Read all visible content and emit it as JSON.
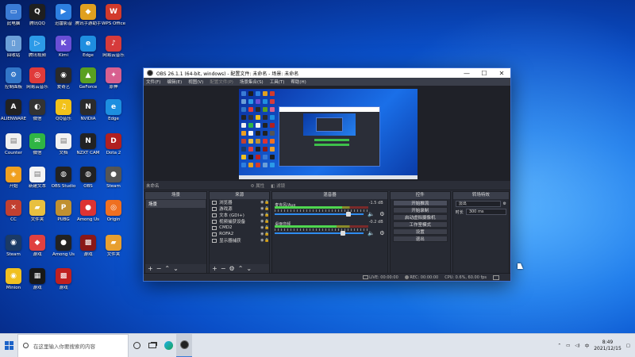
{
  "desktop": {
    "icons": [
      {
        "label": "此电脑",
        "color": "#3a7bd5",
        "glyph": "▭"
      },
      {
        "label": "腾讯QQ",
        "color": "#1f1f1f",
        "glyph": "Q"
      },
      {
        "label": "迅雷影音",
        "color": "#2d7fe0",
        "glyph": "▶"
      },
      {
        "label": "腾讯手游助手",
        "color": "#e0a020",
        "glyph": "◆"
      },
      {
        "label": "WPS Office",
        "color": "#d23a2c",
        "glyph": "W"
      },
      {
        "label": "回收站",
        "color": "#6b9fd8",
        "glyph": "▯"
      },
      {
        "label": "腾讯视频",
        "color": "#2c9ae8",
        "glyph": "▷"
      },
      {
        "label": "Kimi",
        "color": "#6a4fd6",
        "glyph": "K"
      },
      {
        "label": "Edge",
        "color": "#1f8ee0",
        "glyph": "e"
      },
      {
        "label": "网易云音乐",
        "color": "#d63b3b",
        "glyph": "♪"
      },
      {
        "label": "控制面板",
        "color": "#3276c8",
        "glyph": "⚙"
      },
      {
        "label": "网易云音乐",
        "color": "#e03a3a",
        "glyph": "◎"
      },
      {
        "label": "爱奇艺",
        "color": "#2a2a2a",
        "glyph": "◉"
      },
      {
        "label": "GeForce",
        "color": "#5aa020",
        "glyph": "▲"
      },
      {
        "label": "原神",
        "color": "#d86090",
        "glyph": "✦"
      },
      {
        "label": "ALIENWARE",
        "color": "#222",
        "glyph": "A"
      },
      {
        "label": "微信",
        "color": "#333",
        "glyph": "◐"
      },
      {
        "label": "QQ音乐",
        "color": "#f2c21a",
        "glyph": "♫"
      },
      {
        "label": "NVIDIA",
        "color": "#2b2b2b",
        "glyph": "N"
      },
      {
        "label": "Edge",
        "color": "#1d8fe0",
        "glyph": "e"
      },
      {
        "label": "Counter",
        "color": "#f0f0f0",
        "glyph": "▤"
      },
      {
        "label": "微信",
        "color": "#2fb544",
        "glyph": "✉"
      },
      {
        "label": "文档",
        "color": "#f2f2f2",
        "glyph": "▤"
      },
      {
        "label": "NZXT CAM",
        "color": "#222",
        "glyph": "N"
      },
      {
        "label": "Dota 2",
        "color": "#b12020",
        "glyph": "D"
      },
      {
        "label": "开始",
        "color": "#f0a020",
        "glyph": "◈"
      },
      {
        "label": "新建文本",
        "color": "#f4f4f4",
        "glyph": "▤"
      },
      {
        "label": "OBS Studio",
        "color": "#222",
        "glyph": "◍"
      },
      {
        "label": "OBS",
        "color": "#222",
        "glyph": "◍"
      },
      {
        "label": "Steam",
        "color": "#555",
        "glyph": "●"
      },
      {
        "label": "CC",
        "color": "#c24030",
        "glyph": "✕"
      },
      {
        "label": "文件夹",
        "color": "#e8c040",
        "glyph": "▰"
      },
      {
        "label": "PUBG",
        "color": "#c09030",
        "glyph": "P"
      },
      {
        "label": "Among Us",
        "color": "#d33",
        "glyph": "●"
      },
      {
        "label": "Origin",
        "color": "#f07020",
        "glyph": "◎"
      },
      {
        "label": "Steam",
        "color": "#1b3a66",
        "glyph": "◉"
      },
      {
        "label": "游戏",
        "color": "#e04040",
        "glyph": "◆"
      },
      {
        "label": "Among Us",
        "color": "#222",
        "glyph": "●"
      },
      {
        "label": "游戏",
        "color": "#8a1818",
        "glyph": "▩"
      },
      {
        "label": "文件夹",
        "color": "#e8a030",
        "glyph": "▰"
      },
      {
        "label": "Minion",
        "color": "#f0c020",
        "glyph": "◉"
      },
      {
        "label": "游戏",
        "color": "#181818",
        "glyph": "▦"
      },
      {
        "label": "游戏",
        "color": "#c02020",
        "glyph": "▩"
      }
    ]
  },
  "obs": {
    "title": "OBS 26.1.1 (64-bit, windows) - 配置文件: 未命名 - 场景: 未命名",
    "menu": [
      "文件(F)",
      "编辑(E)",
      "视图(V)",
      "配置文件(P)",
      "场景集合(S)",
      "工具(T)",
      "帮助(H)"
    ],
    "source_bar": {
      "label": "未命名",
      "properties": "属性",
      "filters": "滤镜"
    },
    "docks": {
      "scenes": {
        "title": "场景",
        "items": [
          "场景"
        ]
      },
      "sources": {
        "title": "来源",
        "items": [
          "浏览器",
          "游戏源",
          "文本 (GDI+)",
          "视频捕获设备",
          "CMD2",
          "ROFA2",
          "显示器捕获"
        ]
      },
      "mixer": {
        "title": "混音器",
        "channels": [
          {
            "name": "麦克风/Aux",
            "db": "-1.5 dB",
            "level": 0.72,
            "volume": 0.85
          },
          {
            "name": "桌面音频",
            "db": "-0.2 dB",
            "level": 0.66,
            "volume": 0.78
          }
        ]
      },
      "controls": {
        "title": "控件",
        "buttons": [
          "开始推流",
          "开始录制",
          "启动虚拟摄像机",
          "工作室模式",
          "设置",
          "退出"
        ]
      },
      "transitions": {
        "title": "转场特效",
        "type": "淡出",
        "duration_label": "时长",
        "duration": "300 ms"
      }
    },
    "status": {
      "live_label": "LIVE",
      "live_time": "00:00:00",
      "rec_label": "REC",
      "rec_time": "00:00:00",
      "cpu": "CPU: 0.6%, 60.00 fps"
    }
  },
  "taskbar": {
    "search_placeholder": "在这里输入你要搜索的内容",
    "time": "8:49",
    "date": "2021/12/15",
    "lang": "中"
  }
}
